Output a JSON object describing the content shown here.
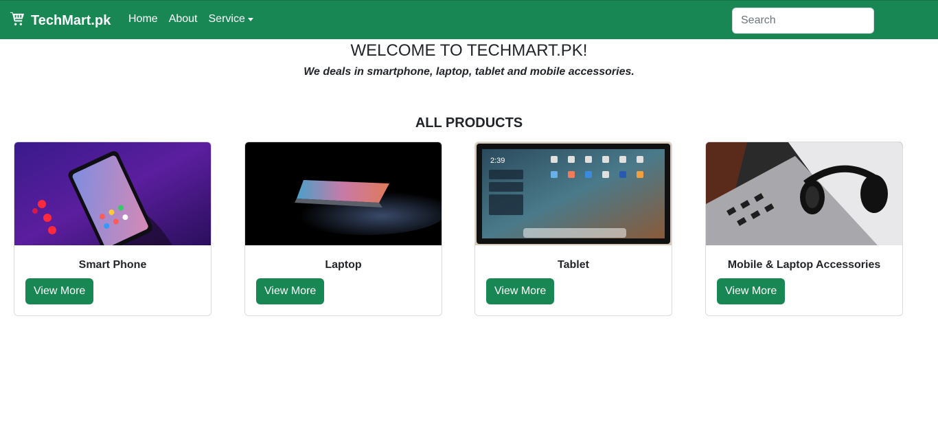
{
  "navbar": {
    "brand": "TechMart.pk",
    "brand_icon": "cart-icon",
    "links": [
      "Home",
      "About",
      "Service"
    ],
    "search_placeholder": "Search"
  },
  "hero": {
    "welcome": "WELCOME TO TECHMART.PK!",
    "tagline": "We deals in smartphone, laptop, tablet and mobile accessories."
  },
  "products": {
    "heading": "ALL PRODUCTS",
    "button_label": "View More",
    "items": [
      {
        "title": "Smart Phone"
      },
      {
        "title": "Laptop"
      },
      {
        "title": "Tablet"
      },
      {
        "title": "Mobile & Laptop Accessories"
      }
    ]
  },
  "colors": {
    "brand_green": "#198754",
    "text": "#212529"
  }
}
